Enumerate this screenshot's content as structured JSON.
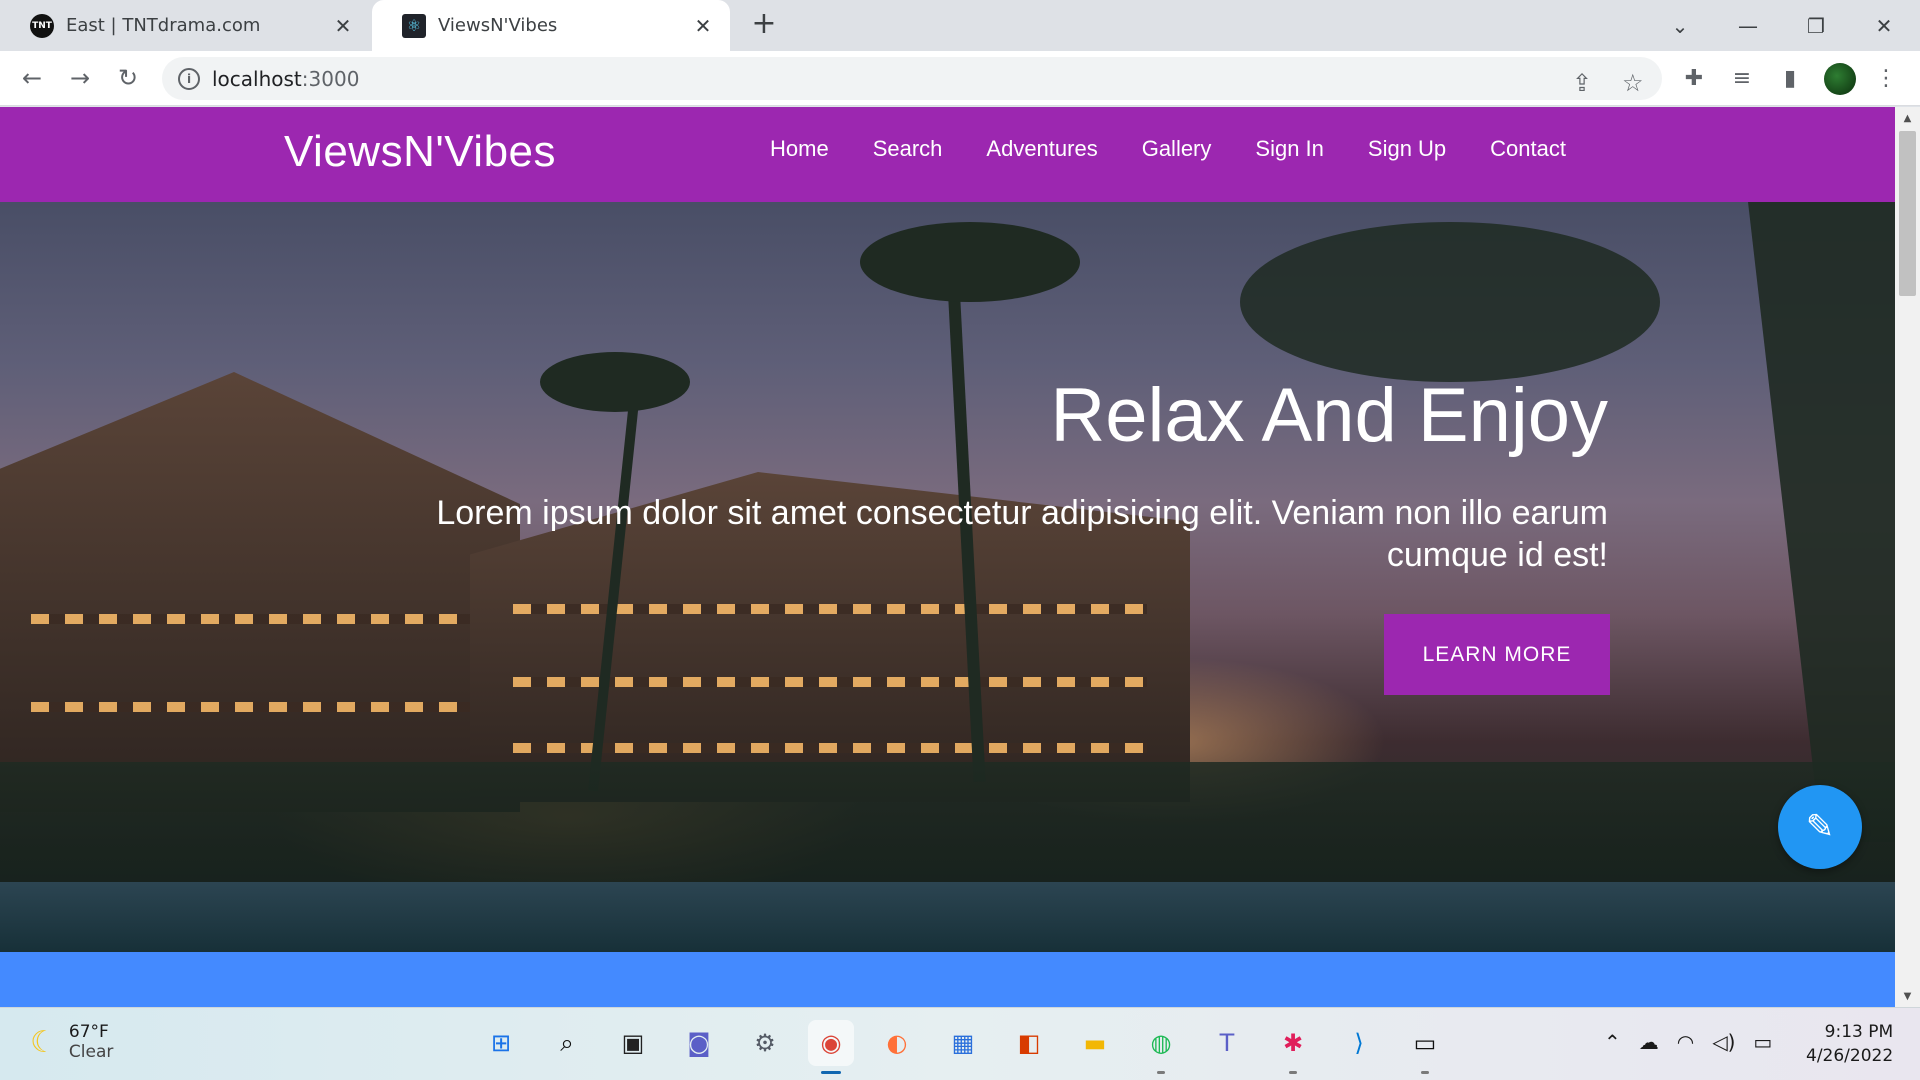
{
  "browser": {
    "tabs": [
      {
        "favicon": "TNT",
        "title": "East | TNTdrama.com",
        "active": false
      },
      {
        "favicon": "⚛",
        "title": "ViewsN'Vibes",
        "active": true
      }
    ],
    "new_tab_glyph": "+",
    "close_glyph": "✕",
    "window_controls": {
      "dropdown": "⌄",
      "minimize": "—",
      "restore": "❐",
      "close": "✕"
    },
    "nav": {
      "back": "←",
      "forward": "→",
      "reload": "↻"
    },
    "address": {
      "host": "localhost",
      "path": ":3000"
    },
    "toolbar_icons": {
      "share": "⇪",
      "bookmark": "☆",
      "extensions": "✚",
      "media": "≡",
      "sidepanel": "▮",
      "menu": "⋮"
    }
  },
  "site": {
    "brand": "ViewsN'Vibes",
    "menu": [
      "Home",
      "Search",
      "Adventures",
      "Gallery",
      "Sign In",
      "Sign Up",
      "Contact"
    ],
    "hero": {
      "title": "Relax And Enjoy",
      "subtitle": "Lorem ipsum dolor sit amet consectetur adipisicing elit. Veniam non illo earum cumque id est!",
      "button": "LEARN MORE"
    },
    "fab_icon": "✎",
    "colors": {
      "primary": "#9c27b0",
      "band": "#448aff",
      "fab": "#2196f3"
    }
  },
  "taskbar": {
    "weather": {
      "icon": "☾",
      "temp": "67°F",
      "condition": "Clear"
    },
    "apps": [
      {
        "name": "windows-start",
        "glyph": "⊞",
        "color": "#1a73e8",
        "active": false,
        "running": false
      },
      {
        "name": "search",
        "glyph": "⌕",
        "color": "#111111",
        "active": false,
        "running": false
      },
      {
        "name": "task-view",
        "glyph": "▣",
        "color": "#222222",
        "active": false,
        "running": false
      },
      {
        "name": "chat",
        "glyph": "◙",
        "color": "#5b5fc7",
        "active": false,
        "running": false
      },
      {
        "name": "settings",
        "glyph": "⚙",
        "color": "#555b66",
        "active": false,
        "running": false
      },
      {
        "name": "chrome",
        "glyph": "◉",
        "color": "#db4437",
        "active": true,
        "running": true
      },
      {
        "name": "firefox",
        "glyph": "◐",
        "color": "#ff7139",
        "active": false,
        "running": false
      },
      {
        "name": "store",
        "glyph": "▦",
        "color": "#2a6fdb",
        "active": false,
        "running": false
      },
      {
        "name": "office",
        "glyph": "◧",
        "color": "#d83b01",
        "active": false,
        "running": false
      },
      {
        "name": "file-explorer",
        "glyph": "▬",
        "color": "#f2b705",
        "active": false,
        "running": false
      },
      {
        "name": "spotify",
        "glyph": "◍",
        "color": "#1db954",
        "active": false,
        "running": true
      },
      {
        "name": "teams",
        "glyph": "T",
        "color": "#5b5fc7",
        "active": false,
        "running": false
      },
      {
        "name": "slack",
        "glyph": "✱",
        "color": "#e01e5a",
        "active": false,
        "running": true
      },
      {
        "name": "vscode",
        "glyph": "⟩",
        "color": "#0078d4",
        "active": false,
        "running": false
      },
      {
        "name": "terminal",
        "glyph": "▭",
        "color": "#111111",
        "active": false,
        "running": true
      }
    ],
    "tray": {
      "chevron": "⌃",
      "cloud": "☁",
      "wifi": "◠",
      "volume": "◁)",
      "battery": "▭"
    },
    "time": "9:13 PM",
    "date": "4/26/2022"
  }
}
